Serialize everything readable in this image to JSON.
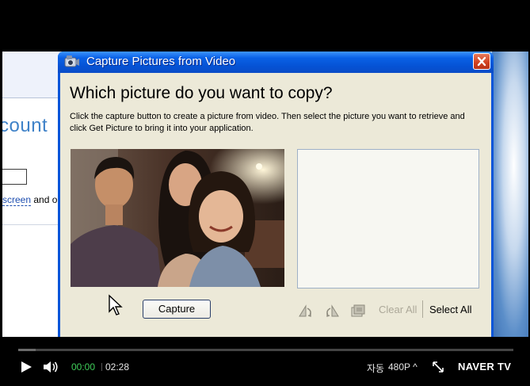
{
  "background_window": {
    "title_fragment": "count",
    "line_link": "screen",
    "line_rest": " and o"
  },
  "dialog": {
    "title": "Capture Pictures from Video",
    "heading": "Which picture do you want to copy?",
    "instructions": "Click the capture button to create a picture from video. Then select the picture you want to retrieve and click Get Picture to bring it into your application.",
    "capture_label": "Capture",
    "toolbar": {
      "icons": [
        "rotate-left-icon",
        "rotate-right-icon",
        "save-picture-icon"
      ],
      "clear_all_label": "Clear All",
      "clear_all_enabled": false,
      "select_all_label": "Select All"
    },
    "colors": {
      "title_bar": "#0a55d9",
      "close_button": "#d0401e",
      "client_bg": "#ece9d8"
    }
  },
  "player": {
    "progress_fraction": 0.035,
    "current_time": "00:00",
    "total_time": "02:28",
    "auto_label": "자동",
    "quality_label": "480P ^",
    "brand": "NAVER TV",
    "colors": {
      "current_time": "#3fcf5a"
    }
  }
}
